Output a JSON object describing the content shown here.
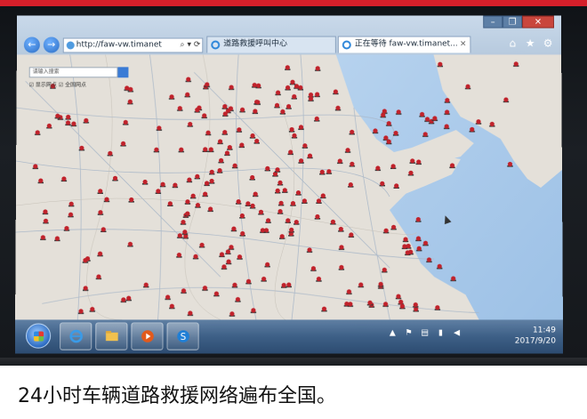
{
  "caption": "24小时车辆道路救援网络遍布全国。",
  "browser": {
    "address": "http://faw-vw.timanet",
    "address_tools": "⌕ ▾ ⟳",
    "tabs": [
      {
        "label": "道路救援呼叫中心"
      },
      {
        "label": "正在等待 faw-vw.timanet..."
      }
    ],
    "tab_close": "×",
    "window_controls": {
      "minimize": "–",
      "restore": "❐",
      "close": "✕"
    },
    "nav": {
      "back": "←",
      "forward": "→"
    }
  },
  "map": {
    "search_placeholder": "请输入搜索",
    "options": "☑ 显示网点  ☑ 全国网点"
  },
  "taskbar": {
    "clock_time": "11:49",
    "clock_date": "2017/9/20"
  },
  "colors": {
    "accent_bar": "#d51f2a",
    "sea": "#a8c8e8",
    "land": "#e4e0d9",
    "marker": "#c0222b",
    "road": "#9fb0c4"
  }
}
